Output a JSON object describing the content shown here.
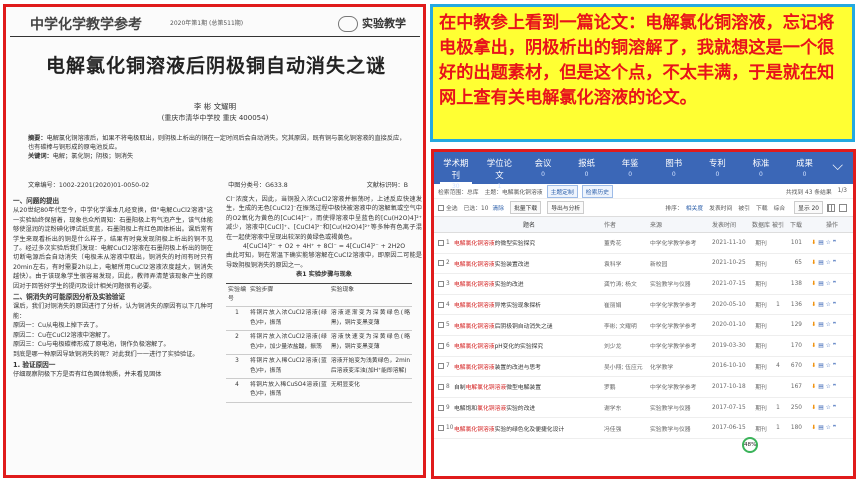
{
  "journal": {
    "logo": "中学化学教学参考",
    "issue": "2020年第1期 (总第511期)",
    "column": "实验教学"
  },
  "paper": {
    "title": "电解氯化铜溶液后阴极铜自动消失之谜",
    "authors": "李 彬 文耀明",
    "affiliation": "(重庆市清华中学校 重庆 400054)",
    "abstract_label": "摘要：",
    "abstract": "电解氯化铜溶液后，如果不将电极取出，则阴极上析出的铜在一定时间后会自动消失。究其原因，既有铜与氯化铜溶液的直接反应，也有碳棒与铜形成的原电池反应。",
    "keywords_label": "关键词：",
    "keywords": "电解；氯化铜；阴极；铜消失",
    "article_no": "文章编号：1002-2201(2020)01-0050-02",
    "clc_no": "中图分类号：G633.8",
    "code": "文献标识码：B",
    "left_col": {
      "h1": "一、问题的提出",
      "p1": "从20世纪80年代至今，中学化学课本几经变换，但\"电解CuCl2溶液\"这一实验始终保留着，现象也众所周知：石墨阳极上有气泡产生，该气体能够使湿润的淀粉碘化钾试纸变蓝，石墨阴极上有红色固体析出。课后常有学生来观看析出的铜是什么样子，结果有时竟发现阴极上析出的铜不见了。经过多次实验后我们发现：电解CuCl2溶液在石墨阴极上析出的铜在切断电源后会自动消失（电极未从溶液中取出，铜消失的时间有时只有20min左右，有时需要2h以上，电解所用CuCl2溶液浓度越大，铜消失越快）。由于该现象学生很容易发现，因此，教师弄清楚该现象产生的原因对于回答好学生的提问及设计相关问题很有必要。",
      "h2": "二、铜消失的可能原因分析及实验验证",
      "p2": "课后，我们对铜消失的原因进行了分析，认为铜消失的原因有以下几种可能：",
      "r1": "原因一：Cu从电极上掉下去了。",
      "r2": "原因二：Cu在CuCl2溶液中溶解了。",
      "r3": "原因三：Cu与电极碳棒形成了原电池，铜作负极溶解了。",
      "p3": "到底是哪一种原因导致铜消失的呢？对此我们一一进行了实验验证。",
      "h3": "1. 验证原因一",
      "p4": "仔细观察阴极下方是否有红色固体物质，并未看见固体"
    },
    "right_col": {
      "p1": "Cl⁻浓度大，因此，当铜投入浓CuCl2溶液并振荡时，上述反应快速发生，生成的无色[CuCl2]⁻在振荡过程中极快被溶液中的溶解氧或空气中的O2氧化为黄色的[CuCl4]²⁻，而使得溶液中呈蓝色的[Cu(H2O)4]²⁺减少，溶液中[CuCl]⁺、[CuCl4]²⁻和[Cu(H2O)4]²⁺等多种有色离子混在一起使溶液中呈现出较深的黄绿色或褐黄色。",
      "eq": "4[CuCl4]²⁻ + O2 + 4H⁺ + 8Cl⁻ = 4[CuCl4]²⁻ + 2H2O",
      "p2": "由此可知，铜在常温下确实能够溶解在CuCl2溶液中，即原因二可能是导致阴极铜消失的原因之一。",
      "table_caption": "表1 实验步骤与现象",
      "table_headers": [
        "实验编号",
        "实验步骤",
        "实验现象"
      ],
      "table_rows": [
        [
          "1",
          "将铜片放入浓CuCl2溶液(绿色)中，振荡",
          "溶液逐渐变为深黄绿色(略黑)，铜片变黑变薄"
        ],
        [
          "2",
          "将铜片放入浓CuCl2溶液(绿色)中，加少量浓盐酸，振荡",
          "溶液快速变为深黄绿色(略黑)，铜片变黑变薄"
        ],
        [
          "3",
          "将铜片放入稀CuCl2溶液(蓝色)中，振荡",
          "溶液开始变为浅黄绿色，2min后溶液变浑浊(加H⁺能即溶解)"
        ],
        [
          "4",
          "将铜片放入稀CuSO4溶液(蓝色)中，振荡",
          "无明显变化"
        ]
      ]
    }
  },
  "note": {
    "text": "在中教参上看到一篇论文：电解氯化铜溶液，忘记将电极拿出，阴极析出的铜溶解了，我就想这是一个很好的出题素材，但是这个点，不太丰满，于是就在知网上查有关电解氯化溶液的论文。"
  },
  "search": {
    "nav": [
      {
        "label": "学术期刊",
        "count": "30"
      },
      {
        "label": "学位论文",
        "count": "1"
      },
      {
        "label": "会议",
        "count": "0"
      },
      {
        "label": "报纸",
        "count": "0"
      },
      {
        "label": "年鉴",
        "count": "0"
      },
      {
        "label": "图书",
        "count": "0"
      },
      {
        "label": "专利",
        "count": "0"
      },
      {
        "label": "标准",
        "count": "0"
      },
      {
        "label": "成果",
        "count": "0"
      }
    ],
    "filter": {
      "range_label": "检索范围：总库",
      "topic_label": "主题：电解氯化铜溶液",
      "chip1": "主题定制",
      "chip2": "检索历史",
      "result_info": "共找到 43 条结果",
      "page": "1/3"
    },
    "tools": {
      "select_all": "全选",
      "selected": "已选：10",
      "clear": "清除",
      "batch_download": "批量下载",
      "export": "导出与分析",
      "sort_label": "排序：",
      "sort_relevance": "相关度",
      "sort_date": "发表时间",
      "sort_cite": "被引",
      "sort_dl": "下载",
      "sort_all": "综合",
      "display": "显示 20"
    },
    "headers": [
      "题名",
      "作者",
      "来源",
      "发表时间",
      "数据库",
      "被引",
      "下载",
      "操作"
    ],
    "rows": [
      {
        "n": "1",
        "pre": "",
        "hl": "电解氯化铜溶液",
        "post": "的微型实验探究",
        "author": "董秀花",
        "source": "中学化学教学参考",
        "date": "2021-11-10",
        "db": "期刊",
        "cite": "",
        "dl": "101"
      },
      {
        "n": "2",
        "pre": "",
        "hl": "电解氯化铜溶液",
        "post": "实验装置改进",
        "author": "袁科学",
        "source": "新校园",
        "date": "2021-10-25",
        "db": "期刊",
        "cite": "",
        "dl": "65"
      },
      {
        "n": "3",
        "pre": "",
        "hl": "电解氯化铜溶液",
        "post": "实验的改进",
        "author": "龚竹涛; 杨文",
        "source": "实验教学与仪器",
        "date": "2021-07-15",
        "db": "期刊",
        "cite": "",
        "dl": "138"
      },
      {
        "n": "4",
        "pre": "",
        "hl": "电解氯化铜溶液",
        "post": "异常实验现象探析",
        "author": "崔丽娟",
        "source": "中学化学教学参考",
        "date": "2020-05-10",
        "db": "期刊",
        "cite": "1",
        "dl": "136"
      },
      {
        "n": "5",
        "pre": "",
        "hl": "电解氯化铜溶液",
        "post": "后阴极铜自动消失之谜",
        "author": "李彬; 文耀明",
        "source": "中学化学教学参考",
        "date": "2020-01-10",
        "db": "期刊",
        "cite": "",
        "dl": "129"
      },
      {
        "n": "6",
        "pre": "",
        "hl": "电解氯化铜溶液",
        "post": "pH变化的实验探究",
        "author": "刘少龙",
        "source": "中学化学教学参考",
        "date": "2019-03-30",
        "db": "期刊",
        "cite": "",
        "dl": "170"
      },
      {
        "n": "7",
        "pre": "",
        "hl": "电解氯化铜溶液",
        "post": "装置的改进与思考",
        "author": "吴小翔; 伍应元",
        "source": "化学教学",
        "date": "2016-10-10",
        "db": "期刊",
        "cite": "4",
        "dl": "670"
      },
      {
        "n": "8",
        "pre": "自制",
        "hl": "电解氯化铜溶液",
        "post": "微型电解装置",
        "author": "罗鹏",
        "source": "中学化学教学参考",
        "date": "2017-10-18",
        "db": "期刊",
        "cite": "",
        "dl": "167"
      },
      {
        "n": "9",
        "pre": "电解饱和",
        "hl": "氯化铜溶液",
        "post": "实验的改进",
        "author": "谢学东",
        "source": "实验教学与仪器",
        "date": "2017-07-15",
        "db": "期刊",
        "cite": "1",
        "dl": "250"
      },
      {
        "n": "10",
        "pre": "",
        "hl": "电解氯化铜溶液",
        "post": "实验的绿色化及便捷化设计",
        "author": "冯佳强",
        "source": "实验教学与仪器",
        "date": "2017-06-15",
        "db": "期刊",
        "cite": "1",
        "dl": "180"
      }
    ],
    "bubble": "48%"
  }
}
